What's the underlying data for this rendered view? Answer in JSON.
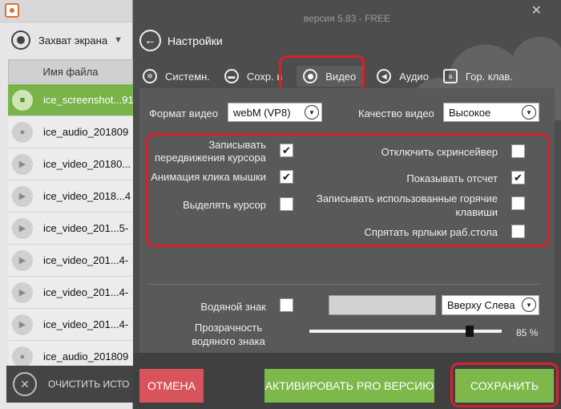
{
  "left_panel": {
    "capture_label": "Захват экрана",
    "column_header": "Имя файла",
    "files": [
      {
        "name": "ice_screenshot...91",
        "icon": "camera-icon",
        "selected": true
      },
      {
        "name": "ice_audio_201809",
        "icon": "microphone-icon",
        "selected": false
      },
      {
        "name": "ice_video_20180...",
        "icon": "play-icon",
        "selected": false
      },
      {
        "name": "ice_video_2018...4",
        "icon": "play-icon",
        "selected": false
      },
      {
        "name": "ice_video_201...5-",
        "icon": "play-icon",
        "selected": false
      },
      {
        "name": "ice_video_201...4-",
        "icon": "play-icon",
        "selected": false
      },
      {
        "name": "ice_video_201...4-",
        "icon": "play-icon",
        "selected": false
      },
      {
        "name": "ice_video_201...4-",
        "icon": "play-icon",
        "selected": false
      },
      {
        "name": "ice_audio_201809",
        "icon": "microphone-icon",
        "selected": false
      }
    ],
    "clear_label": "ОЧИСТИТЬ ИСТО"
  },
  "dialog": {
    "version": "версия 5.83 - FREE",
    "title": "Настройки",
    "tabs": [
      {
        "label": "Системн.",
        "icon": "gear-icon",
        "active": false
      },
      {
        "label": "Сохр. в",
        "icon": "folder-icon",
        "active": false
      },
      {
        "label": "Видео",
        "icon": "record-icon",
        "active": true
      },
      {
        "label": "Аудио",
        "icon": "speaker-icon",
        "active": false
      },
      {
        "label": "Гор. клав.",
        "icon": "keyboard-icon",
        "active": false
      }
    ],
    "video_format": {
      "label": "Формат видео",
      "value": "webM (VP8)"
    },
    "video_quality": {
      "label": "Качество видео",
      "value": "Высокое"
    },
    "options": {
      "record_cursor": {
        "label": "Записывать передвижения курсора",
        "checked": true
      },
      "click_animation": {
        "label": "Анимация клика мышки",
        "checked": true
      },
      "highlight_cursor": {
        "label": "Выделять курсор",
        "checked": false
      },
      "disable_screensaver": {
        "label": "Отключить скринсейвер",
        "checked": false
      },
      "show_countdown": {
        "label": "Показывать отсчет",
        "checked": true
      },
      "record_hotkeys": {
        "label": "Записывать использованные горячие клавиши",
        "checked": false
      },
      "hide_desktop_icons": {
        "label": "Спрятать ярлыки раб.стола",
        "checked": false
      }
    },
    "watermark": {
      "label": "Водяной знак",
      "checked": false,
      "position": "Вверху Слева"
    },
    "opacity": {
      "label": "Прозрачность водяного знака",
      "value": "85 %",
      "level": 0.85
    },
    "buttons": {
      "cancel": "ОТМЕНА",
      "activate_pro": "АКТИВИРОВАТЬ PRO ВЕРСИЮ",
      "save": "СОХРАНИТЬ"
    },
    "colors": {
      "highlight": "#d8202a",
      "green": "#7cb84a",
      "cancel": "#d9535a"
    }
  }
}
